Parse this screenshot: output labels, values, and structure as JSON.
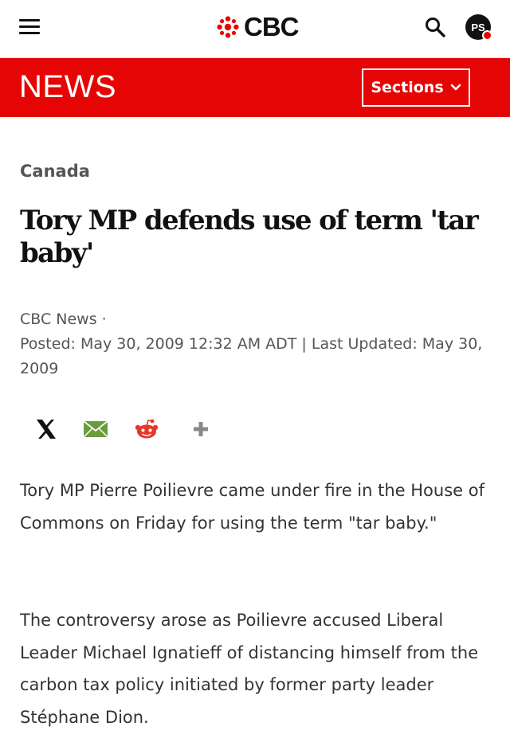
{
  "header": {
    "logo_text": "CBC",
    "avatar_initials": "PS",
    "icons": [
      "menu-icon",
      "cbc-gem-icon",
      "search-icon"
    ]
  },
  "newsbar": {
    "label": "NEWS",
    "sections_label": "Sections"
  },
  "article": {
    "category": "Canada",
    "headline": "Tory MP defends use of term 'tar baby'",
    "byline_source": "CBC News ·",
    "byline_dates": "Posted: May 30, 2009 12:32 AM ADT | Last Updated: May 30, 2009",
    "share_icons": [
      "x-icon",
      "email-icon",
      "reddit-icon",
      "plus-icon"
    ],
    "paragraphs": [
      "Tory MP Pierre Poilievre came under fire in the House of Commons on Friday for using the term \"tar baby.\"",
      "The controversy arose as Poilievre accused Liberal Leader Michael Ignatieff of distancing himself from the carbon tax policy initiated by former party leader Stéphane Dion."
    ]
  },
  "colors": {
    "brand_red": "#e60505",
    "text_dark": "#111111",
    "text_muted": "#555555",
    "mail_green": "#6a9c3f",
    "reddit_red": "#e8382a",
    "plus_gray": "#888888"
  }
}
